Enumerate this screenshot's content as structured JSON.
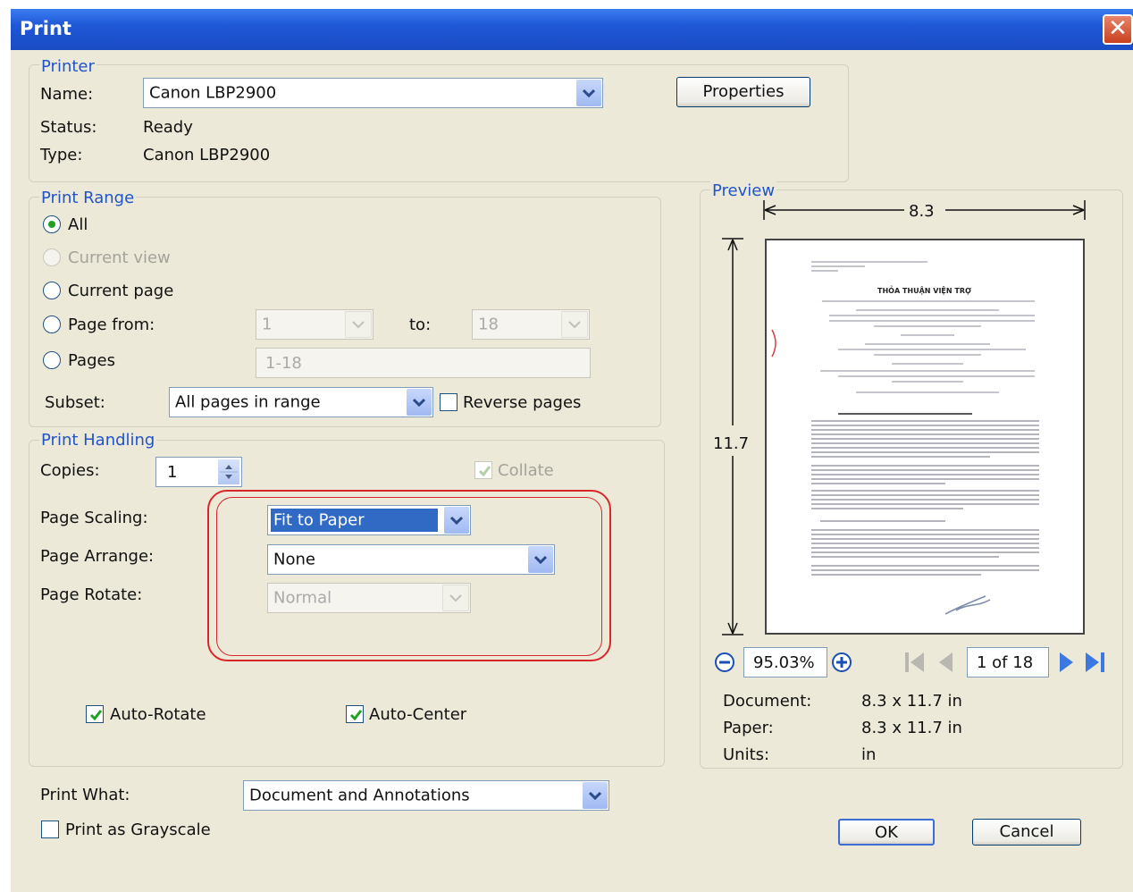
{
  "dialog": {
    "title": "Print"
  },
  "printer": {
    "group_label": "Printer",
    "name_label": "Name:",
    "name_value": "Canon LBP2900",
    "properties_label": "Properties",
    "status_label": "Status:",
    "status_value": "Ready",
    "type_label": "Type:",
    "type_value": "Canon LBP2900"
  },
  "print_range": {
    "group_label": "Print Range",
    "all_label": "All",
    "current_view_label": "Current view",
    "current_page_label": "Current page",
    "page_from_label": "Page from:",
    "page_from_value": "1",
    "to_label": "to:",
    "to_value": "18",
    "pages_label": "Pages",
    "pages_value": "1-18",
    "subset_label": "Subset:",
    "subset_value": "All pages in range",
    "reverse_label": "Reverse pages"
  },
  "print_handling": {
    "group_label": "Print Handling",
    "copies_label": "Copies:",
    "copies_value": "1",
    "collate_label": "Collate",
    "scaling_label": "Page Scaling:",
    "scaling_value": "Fit to Paper",
    "arrange_label": "Page Arrange:",
    "arrange_value": "None",
    "rotate_label": "Page Rotate:",
    "rotate_value": "Normal",
    "auto_rotate_label": "Auto-Rotate",
    "auto_center_label": "Auto-Center"
  },
  "print_what": {
    "label": "Print What:",
    "value": "Document and Annotations"
  },
  "grayscale_label": "Print as Grayscale",
  "preview": {
    "group_label": "Preview",
    "width_dim": "8.3",
    "height_dim": "11.7",
    "zoom": "95.03%",
    "page_indicator": "1 of 18",
    "document_label": "Document:",
    "document_value": "8.3 x 11.7 in",
    "paper_label": "Paper:",
    "paper_value": "8.3 x 11.7 in",
    "units_label": "Units:",
    "units_value": "in",
    "doc_heading": "THỎA THUẬN VIỆN TRỢ"
  },
  "buttons": {
    "ok": "OK",
    "cancel": "Cancel"
  },
  "colors": {
    "title_bar": "#1f57d6",
    "group_label": "#2054c8",
    "highlight_oval": "#d8272a",
    "dialog_bg": "#ece9d8"
  }
}
